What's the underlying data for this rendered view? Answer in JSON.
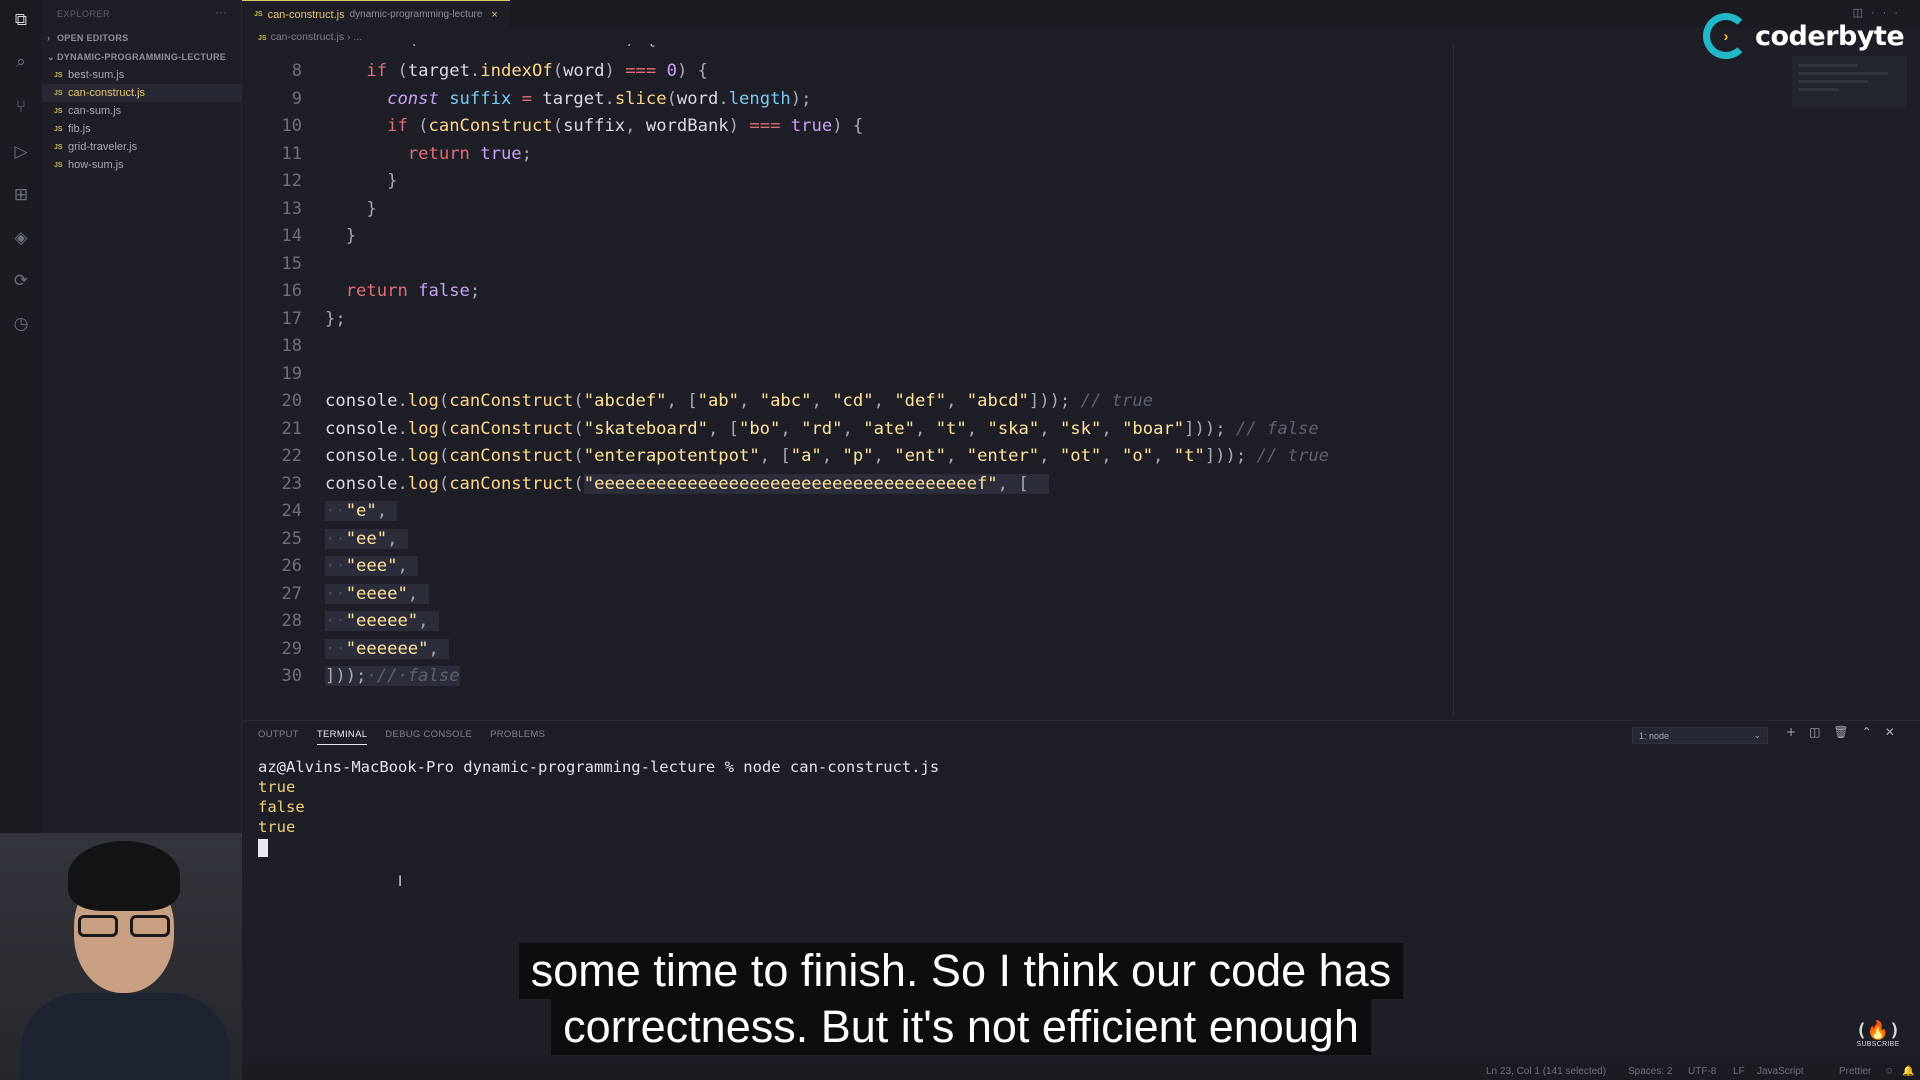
{
  "sidebar": {
    "title": "EXPLORER",
    "open_editors": "OPEN EDITORS",
    "folder": "DYNAMIC-PROGRAMMING-LECTURE",
    "files": [
      "best-sum.js",
      "can-construct.js",
      "can-sum.js",
      "fib.js",
      "grid-traveler.js",
      "how-sum.js"
    ],
    "file_badge": "JS"
  },
  "tab": {
    "name": "can-construct.js",
    "desc": "dynamic-programming-lecture",
    "close": "×"
  },
  "breadcrumb": "can-construct.js › ...",
  "logo": {
    "text": "coderbyte"
  },
  "editor": {
    "line_numbers": [
      "8",
      "9",
      "10",
      "11",
      "12",
      "13",
      "14",
      "15",
      "16",
      "17",
      "18",
      "19",
      "20",
      "21",
      "22",
      "23",
      "24",
      "25",
      "26",
      "27",
      "28",
      "29",
      "30"
    ]
  },
  "panel": {
    "tabs": [
      "OUTPUT",
      "TERMINAL",
      "DEBUG CONSOLE",
      "PROBLEMS"
    ],
    "select": "1: node",
    "terminal": {
      "command": "az@Alvins-MacBook-Pro dynamic-programming-lecture % node can-construct.js",
      "outputs": [
        "true",
        "false",
        "true"
      ]
    }
  },
  "status": {
    "position": "Ln 23, Col 1 (141 selected)",
    "spaces": "Spaces: 2",
    "encoding": "UTF-8",
    "eol": "LF",
    "language": "JavaScript",
    "formatter": "Prettier"
  },
  "caption": {
    "line1": "some time to finish. So I think our code has",
    "line2": "correctness. But it's not efficient enough"
  },
  "watermark": {
    "sub": "SUBSCRIBE"
  },
  "colors": {
    "accent": "#e3c46b",
    "background": "#1e1f26",
    "logo": "#22b8c9"
  }
}
